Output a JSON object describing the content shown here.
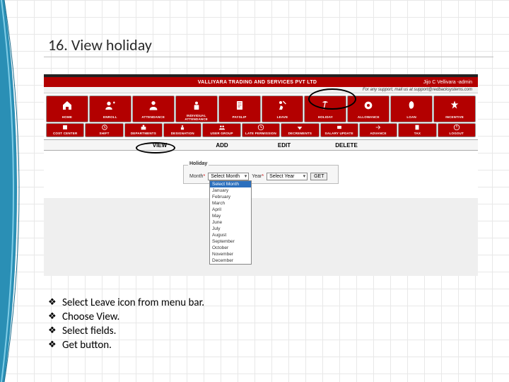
{
  "slide": {
    "title": "16. View holiday"
  },
  "app": {
    "company": "VALLIYARA TRADING AND SERVICES PVT LTD",
    "user": "Jijo C Vellivara -admin",
    "support": "For any support, mail us at support@redbacksystems.com",
    "toolbar_row1": [
      {
        "label": "HOME",
        "name": "home-icon"
      },
      {
        "label": "ENROLL",
        "name": "enroll-icon"
      },
      {
        "label": "ATTENDANCE",
        "name": "attendance-icon"
      },
      {
        "label": "INDIVIDUAL ATTENDANCE",
        "name": "individual-attendance-icon"
      },
      {
        "label": "PAYSLIP",
        "name": "payslip-icon"
      },
      {
        "label": "LEAVE",
        "name": "leave-icon"
      },
      {
        "label": "HOLIDAY",
        "name": "holiday-icon"
      },
      {
        "label": "ALLOWANCE",
        "name": "allowance-icon"
      },
      {
        "label": "LOAN",
        "name": "loan-icon"
      },
      {
        "label": "INCENTIVE",
        "name": "incentive-icon"
      }
    ],
    "toolbar_row2": [
      {
        "label": "COST CENTER",
        "name": "cost-center-icon"
      },
      {
        "label": "SHIFT",
        "name": "shift-icon"
      },
      {
        "label": "DEPARTMENTS",
        "name": "departments-icon"
      },
      {
        "label": "DESIGNATION",
        "name": "designation-icon"
      },
      {
        "label": "USER GROUP",
        "name": "user-group-icon"
      },
      {
        "label": "LATE PERMISSION",
        "name": "late-permission-icon"
      },
      {
        "label": "DECREMENTS",
        "name": "decrements-icon"
      },
      {
        "label": "SALARY UPDATE",
        "name": "salary-update-icon"
      },
      {
        "label": "ADVANCE",
        "name": "advance-icon"
      },
      {
        "label": "TAX",
        "name": "tax-icon"
      },
      {
        "label": "LOGOUT",
        "name": "logout-icon"
      }
    ],
    "tabs": {
      "view": "VIEW",
      "add": "ADD",
      "edit": "EDIT",
      "delete": "DELETE"
    },
    "holiday_panel": {
      "legend": "Holiday",
      "month_label": "Month",
      "month_value": "Select Month",
      "year_label": "Year",
      "year_value": "Select Year",
      "get": "GET",
      "required": "*",
      "months": [
        "Select Month",
        "January",
        "February",
        "March",
        "April",
        "May",
        "June",
        "July",
        "August",
        "September",
        "October",
        "November",
        "December"
      ]
    }
  },
  "instructions": [
    "Select Leave icon from menu bar.",
    "Choose View.",
    "Select fields.",
    "Get button."
  ],
  "bullet_glyph": "❖"
}
